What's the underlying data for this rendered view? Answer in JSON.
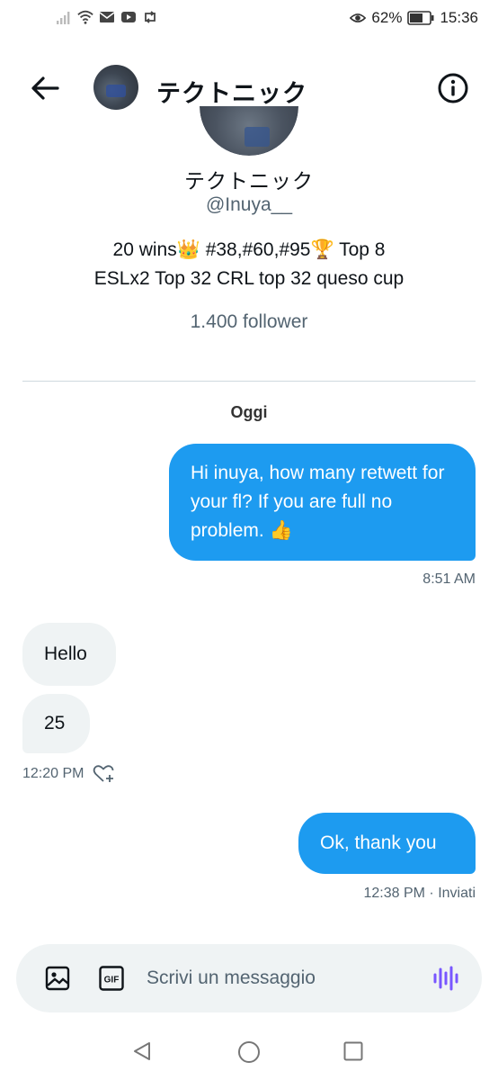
{
  "status_bar": {
    "battery": "62%",
    "time": "15:36"
  },
  "header": {
    "title": "テクトニック",
    "back_icon": "back-arrow-icon",
    "info_icon": "info-icon"
  },
  "profile": {
    "name": "テクトニック",
    "handle": "@Inuya__",
    "bio_line1": "20 wins👑 #38,#60,#95🏆 Top 8",
    "bio_line2": "ESLx2 Top 32 CRL top 32 queso cup",
    "followers": "1.400 follower"
  },
  "conversation": {
    "day_label": "Oggi",
    "messages": [
      {
        "direction": "out",
        "text": "Hi inuya, how many retwett for your fl? If you are full no problem. 👍",
        "time": "8:51 AM"
      },
      {
        "direction": "in",
        "text": "Hello"
      },
      {
        "direction": "in",
        "text": "25",
        "time": "12:20 PM"
      },
      {
        "direction": "out",
        "text": "Ok, thank you",
        "time": "12:38 PM · Inviati"
      }
    ]
  },
  "composer": {
    "placeholder": "Scrivi un messaggio",
    "gif_label": "GIF"
  },
  "colors": {
    "accent": "#1d9bf0",
    "incoming_bubble": "#eff3f4",
    "secondary_text": "#536471",
    "voice_icon": "#7856ff"
  }
}
